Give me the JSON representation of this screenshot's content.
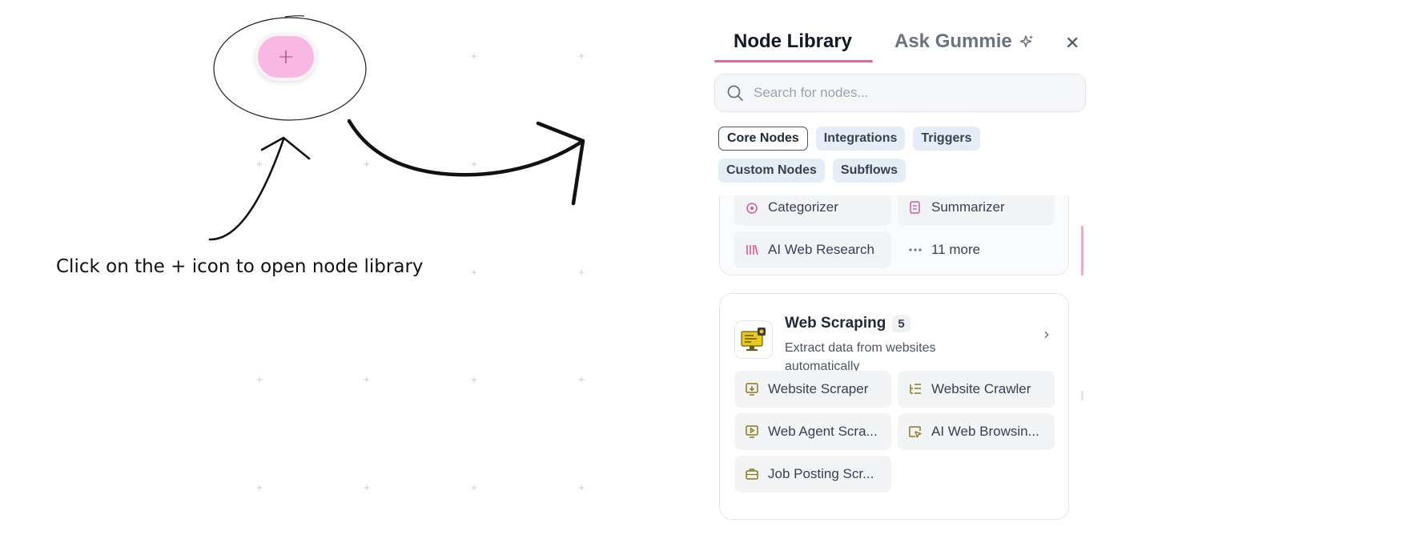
{
  "instruction": "Click on the + icon to open node library",
  "add_button": {
    "glyph": "+",
    "icon": "plus-icon"
  },
  "panel": {
    "tabs": [
      {
        "label": "Node Library",
        "active": true
      },
      {
        "label": "Ask Gummie",
        "icon": "sparkle-icon"
      }
    ],
    "close_icon": "close-icon",
    "search": {
      "placeholder": "Search for nodes...",
      "value": ""
    },
    "filters": [
      {
        "label": "Core Nodes",
        "active": true
      },
      {
        "label": "Integrations"
      },
      {
        "label": "Triggers"
      },
      {
        "label": "Custom Nodes"
      },
      {
        "label": "Subflows"
      }
    ],
    "ai_card": {
      "items": [
        {
          "label": "Categorizer",
          "icon": "categorizer-icon"
        },
        {
          "label": "Summarizer",
          "icon": "summarizer-icon"
        },
        {
          "label": "AI Web Research",
          "icon": "library-icon"
        },
        {
          "label": "11 more",
          "icon": "more-dots-icon"
        }
      ]
    },
    "web_card": {
      "title": "Web Scraping",
      "count": "5",
      "description": "Extract data from websites automatically",
      "items": [
        {
          "label": "Website Scraper",
          "icon": "monitor-download-icon"
        },
        {
          "label": "Website Crawler",
          "icon": "list-tree-icon"
        },
        {
          "label": "Web Agent Scra...",
          "icon": "monitor-play-icon"
        },
        {
          "label": "AI Web Browsin...",
          "icon": "cursor-window-icon"
        },
        {
          "label": "Job Posting Scr...",
          "icon": "briefcase-icon"
        }
      ]
    }
  },
  "colors": {
    "accent": "#e8669f",
    "add_button": "#f9b8e4",
    "ai_icon": "#d6589a",
    "web_icon": "#8a7a1a"
  }
}
